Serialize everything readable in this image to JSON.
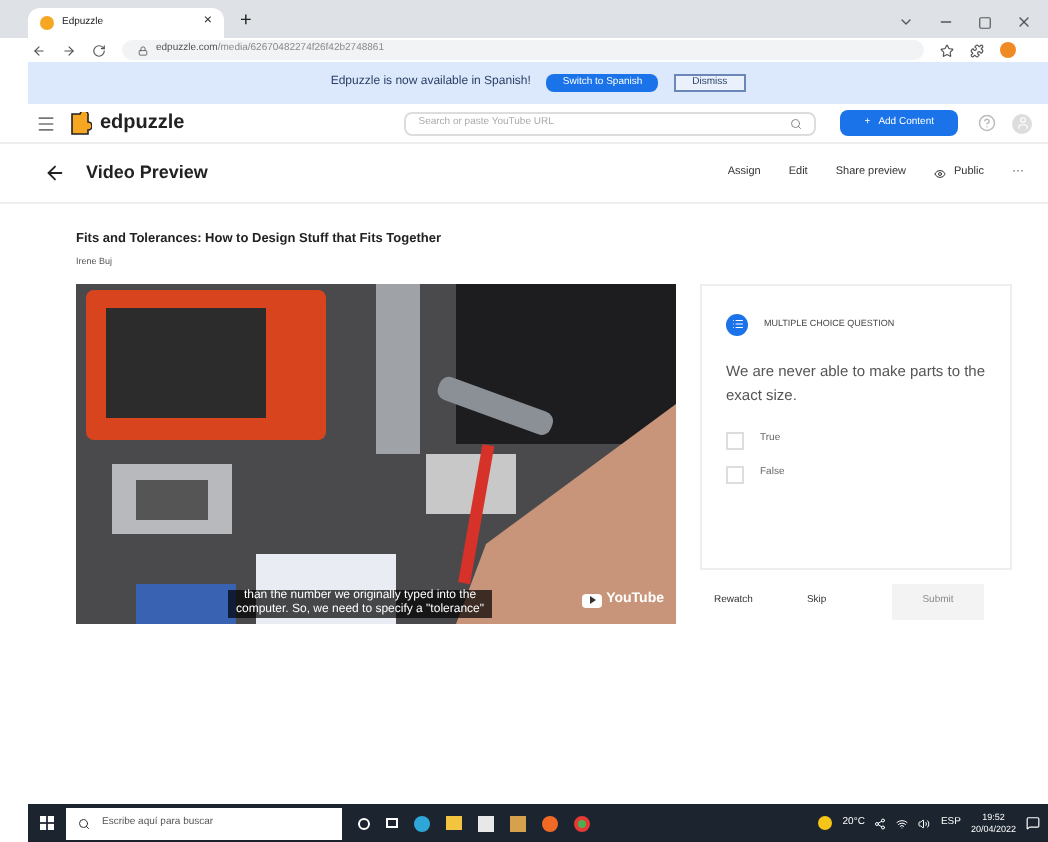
{
  "browser": {
    "tab_title": "Edpuzzle",
    "tab_close": "×",
    "new_tab": "+",
    "url_host": "edpuzzle.com",
    "url_path": "/media/62670482274f26f42b2748861"
  },
  "banner": {
    "text": "Edpuzzle is now available in Spanish!",
    "buttons": [
      "Switch to Spanish",
      "Dismiss"
    ]
  },
  "header": {
    "logo": "edpuzzle",
    "search": {
      "placeholder": "Search or paste YouTube URL"
    },
    "add_button": "Add Content",
    "add_icon": "+"
  },
  "toolbar": {
    "title": "Video Preview",
    "actions": [
      "Assign",
      "Edit",
      "Share preview",
      "Public"
    ],
    "more": "···"
  },
  "video": {
    "title": "Fits and Tolerances: How to Design Stuff that Fits Together",
    "author": "Irene Buj",
    "caption": [
      "than the number we originally typed into the",
      "computer. So, we need to specify a \"tolerance\""
    ],
    "player_logo": "YouTube"
  },
  "question": {
    "type_label": "MULTIPLE CHOICE QUESTION",
    "prompt": "We are never able to make parts to the exact size.",
    "options": [
      {
        "label": "True",
        "checked": false
      },
      {
        "label": "False",
        "checked": false
      }
    ],
    "actions": [
      {
        "label": "Rewatch",
        "disabled": false
      },
      {
        "label": "Skip",
        "disabled": false
      },
      {
        "label": "Submit",
        "disabled": true
      }
    ]
  },
  "taskbar": {
    "search": {
      "placeholder": "Escribe aquí para buscar"
    },
    "weather": "20°C",
    "language": "ESP",
    "time": "19:52",
    "date": "20/04/2022"
  }
}
